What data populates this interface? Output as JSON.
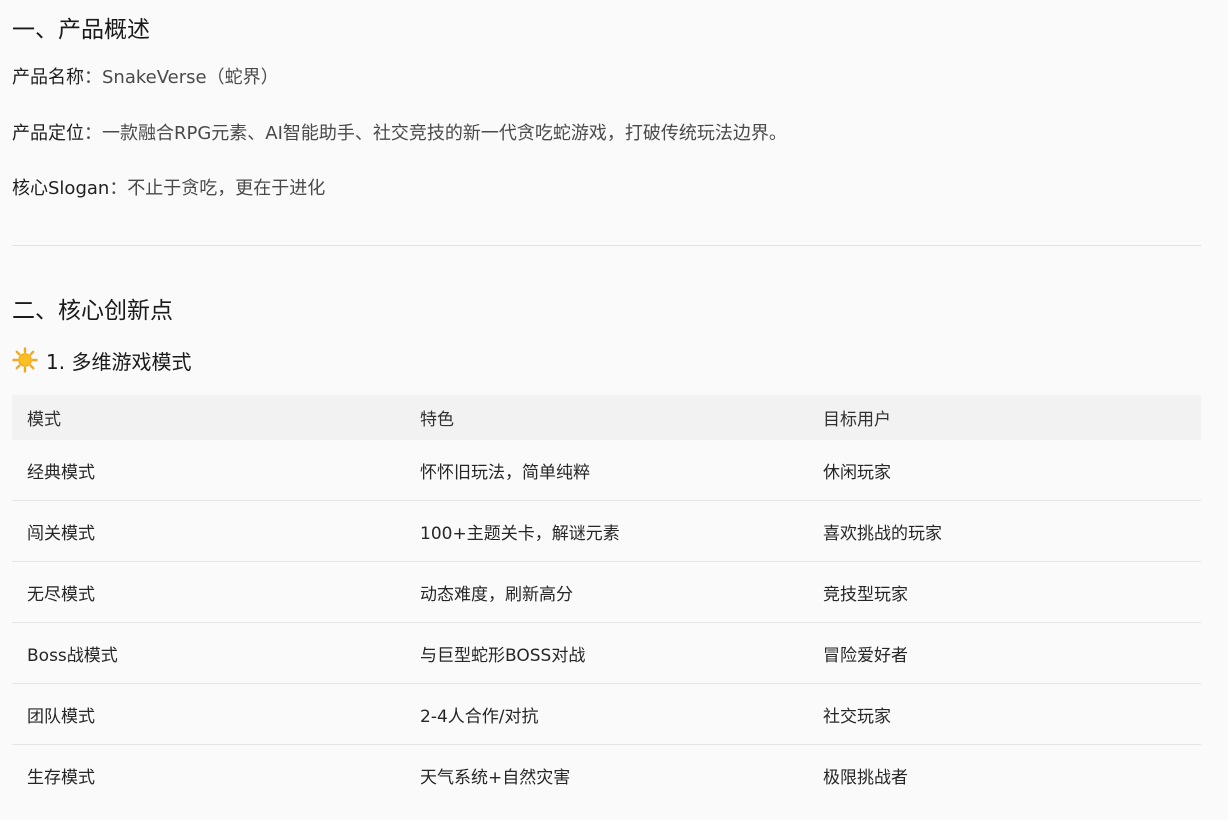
{
  "overview": {
    "heading": "一、产品概述",
    "name_label": "产品名称",
    "name_value": "：SnakeVerse（蛇界）",
    "position_label": "产品定位",
    "position_value": "：一款融合RPG元素、AI智能助手、社交竞技的新一代贪吃蛇游戏，打破传统玩法边界。",
    "slogan_label": "核心Slogan",
    "slogan_value": "：不止于贪吃，更在于进化"
  },
  "innovation": {
    "heading": "二、核心创新点",
    "sub_icon": "sun-emoji-icon",
    "sub_heading": "1. 多维游戏模式",
    "table": {
      "headers": [
        "模式",
        "特色",
        "目标用户"
      ],
      "rows": [
        [
          "经典模式",
          "怀怀旧玩法，简单纯粹",
          "休闲玩家"
        ],
        [
          "闯关模式",
          "100+主题关卡，解谜元素",
          "喜欢挑战的玩家"
        ],
        [
          "无尽模式",
          "动态难度，刷新高分",
          "竞技型玩家"
        ],
        [
          "Boss战模式",
          "与巨型蛇形BOSS对战",
          "冒险爱好者"
        ],
        [
          "团队模式",
          "2-4人合作/对抗",
          "社交玩家"
        ],
        [
          "生存模式",
          "天气系统+自然灾害",
          "极限挑战者"
        ]
      ]
    }
  }
}
